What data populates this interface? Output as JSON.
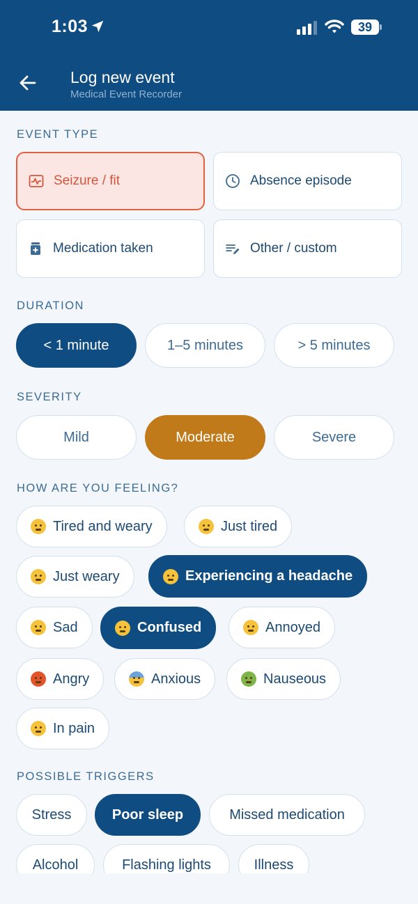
{
  "status_bar": {
    "time": "1:03",
    "battery": "39"
  },
  "header": {
    "title": "Log new event",
    "subtitle": "Medical Event Recorder"
  },
  "sections": {
    "event_type": "EVENT TYPE",
    "duration": "DURATION",
    "severity": "SEVERITY",
    "feeling": "HOW ARE YOU FEELING?",
    "triggers": "POSSIBLE TRIGGERS"
  },
  "event_types": [
    {
      "label": "Seizure / fit",
      "icon": "pulse-icon",
      "selected": true
    },
    {
      "label": "Absence episode",
      "icon": "clock-icon",
      "selected": false
    },
    {
      "label": "Medication taken",
      "icon": "medication-icon",
      "selected": false
    },
    {
      "label": "Other / custom",
      "icon": "edit-list-icon",
      "selected": false
    }
  ],
  "durations": [
    {
      "label": "< 1 minute",
      "selected": true
    },
    {
      "label": "1–5 minutes",
      "selected": false
    },
    {
      "label": "> 5 minutes",
      "selected": false
    }
  ],
  "severities": [
    {
      "label": "Mild",
      "selected": false
    },
    {
      "label": "Moderate",
      "selected": true
    },
    {
      "label": "Severe",
      "selected": false
    }
  ],
  "feelings": [
    {
      "label": "Tired and weary",
      "icon": "sleepy-face-icon",
      "selected": false
    },
    {
      "label": "Just tired",
      "icon": "sleepy-sweat-face-icon",
      "selected": false
    },
    {
      "label": "Just weary",
      "icon": "weary-face-icon",
      "selected": false
    },
    {
      "label": "Experiencing a headache",
      "icon": "dizzy-face-icon",
      "selected": true
    },
    {
      "label": "Sad",
      "icon": "crying-face-icon",
      "selected": false
    },
    {
      "label": "Confused",
      "icon": "astonished-face-icon",
      "selected": true
    },
    {
      "label": "Annoyed",
      "icon": "annoyed-face-icon",
      "selected": false
    },
    {
      "label": "Angry",
      "icon": "angry-face-icon",
      "selected": false
    },
    {
      "label": "Anxious",
      "icon": "anxious-face-icon",
      "selected": false
    },
    {
      "label": "Nauseous",
      "icon": "nauseous-face-icon",
      "selected": false
    },
    {
      "label": "In pain",
      "icon": "pain-face-icon",
      "selected": false
    }
  ],
  "triggers": [
    {
      "label": "Stress",
      "selected": false
    },
    {
      "label": "Poor sleep",
      "selected": true
    },
    {
      "label": "Missed medication",
      "selected": false
    },
    {
      "label": "Alcohol",
      "selected": false
    },
    {
      "label": "Flashing lights",
      "selected": false
    },
    {
      "label": "Illness",
      "selected": false
    }
  ],
  "colors": {
    "primary": "#0f4c81",
    "accent_selected": "#d5553a",
    "severity_selected": "#c07a1a",
    "background": "#f3f7fb"
  }
}
